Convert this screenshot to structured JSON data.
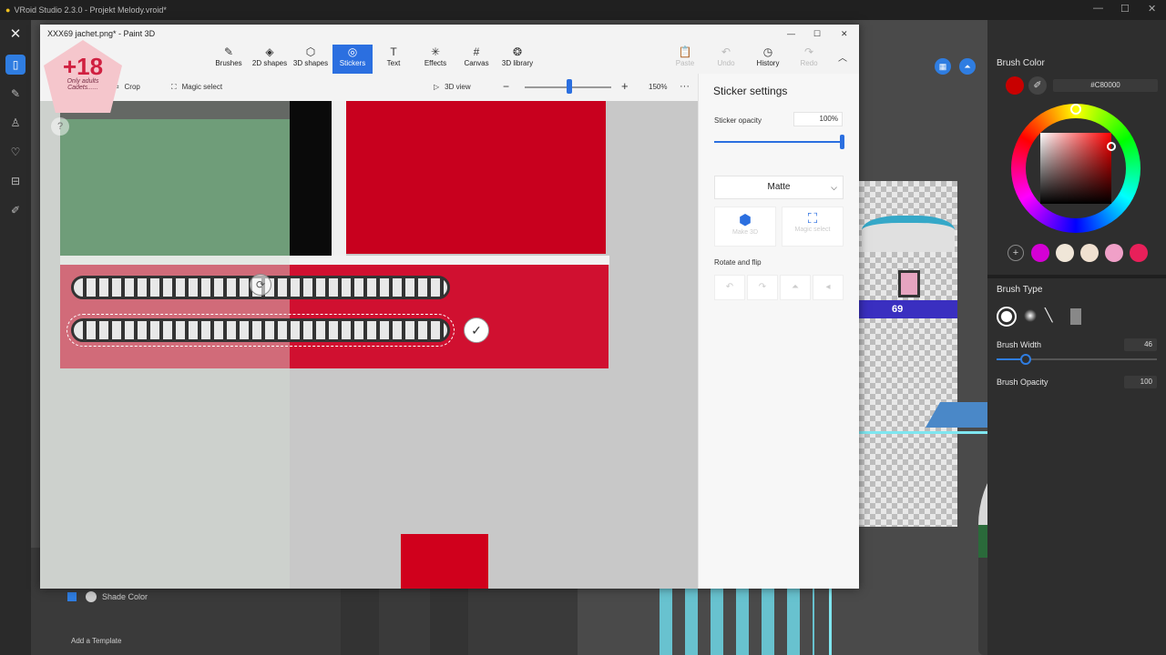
{
  "vroid": {
    "title": "VRoid Studio 2.3.0 - Projekt Melody.vroid*",
    "right_panel": {
      "brush_color_label": "Brush Color",
      "hex_value": "#C80000",
      "swatches": [
        "#d400d4",
        "#f0e6d8",
        "#f0e0d0",
        "#f0a0c8",
        "#e8205a"
      ],
      "brush_type_label": "Brush Type",
      "brush_width_label": "Brush Width",
      "brush_width_value": "46",
      "brush_opacity_label": "Brush Opacity",
      "brush_opacity_value": "100"
    },
    "bottom": {
      "shade_color_label": "Shade Color",
      "add_template_label": "Add a Template"
    },
    "texture_label": "69"
  },
  "paint3d": {
    "title": "XXX69 jachet.png* - Paint 3D",
    "tools": [
      {
        "label": "Brushes",
        "icon": "✎"
      },
      {
        "label": "2D shapes",
        "icon": "◈"
      },
      {
        "label": "3D shapes",
        "icon": "⬡"
      },
      {
        "label": "Stickers",
        "icon": "◎"
      },
      {
        "label": "Text",
        "icon": "T"
      },
      {
        "label": "Effects",
        "icon": "✳"
      },
      {
        "label": "Canvas",
        "icon": "#"
      },
      {
        "label": "3D library",
        "icon": "❂"
      }
    ],
    "right_tools": [
      {
        "label": "Paste",
        "icon": "📋"
      },
      {
        "label": "Undo",
        "icon": "↶"
      },
      {
        "label": "History",
        "icon": "◷"
      },
      {
        "label": "Redo",
        "icon": "↷"
      }
    ],
    "subbar": {
      "crop_label": "Crop",
      "magic_select_label": "Magic select",
      "view_3d_label": "3D view",
      "zoom_value": "150%",
      "more": "···"
    },
    "sticker_settings": {
      "title": "Sticker settings",
      "opacity_label": "Sticker opacity",
      "opacity_value": "100%",
      "opacity_level": 1.0,
      "finish": "Matte",
      "make_3d_label": "Make 3D",
      "magic_select_label": "Magic select",
      "rotate_label": "Rotate and flip"
    },
    "badge": {
      "big": "+18",
      "line1": "Only adults",
      "line2": "Cadets......"
    }
  }
}
